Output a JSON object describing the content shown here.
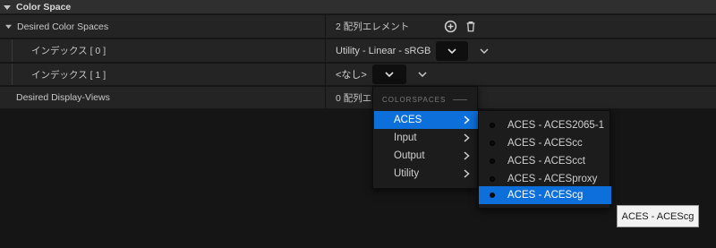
{
  "section": {
    "title": "Color Space"
  },
  "rows": {
    "desired_color_spaces": {
      "label": "Desired Color Spaces",
      "value": "2 配列エレメント"
    },
    "index0": {
      "label": "インデックス [ 0 ]",
      "value": "Utility - Linear - sRGB"
    },
    "index1": {
      "label": "インデックス [ 1 ]",
      "value": "<なし>"
    },
    "desired_display_views": {
      "label": "Desired Display-Views",
      "value": "0 配列エレ"
    }
  },
  "menu": {
    "header": "COLORSPACES",
    "items": [
      {
        "label": "ACES",
        "active": true
      },
      {
        "label": "Input",
        "active": false
      },
      {
        "label": "Output",
        "active": false
      },
      {
        "label": "Utility",
        "active": false
      }
    ]
  },
  "submenu": {
    "items": [
      {
        "label": "ACES - ACES2065-1",
        "active": false
      },
      {
        "label": "ACES - ACEScc",
        "active": false
      },
      {
        "label": "ACES - ACEScct",
        "active": false
      },
      {
        "label": "ACES - ACESproxy",
        "active": false
      },
      {
        "label": "ACES - ACEScg",
        "active": true
      }
    ]
  },
  "tooltip": {
    "text": "ACES - ACEScg"
  },
  "icons": {
    "collapse": "triangle-down-icon",
    "add": "plus-circle-icon",
    "delete": "trash-icon",
    "dropdown": "chevron-down-icon",
    "submenu": "chevron-right-icon"
  },
  "colors": {
    "accent": "#0d6fd9",
    "background": "#151515",
    "row": "#242424"
  }
}
